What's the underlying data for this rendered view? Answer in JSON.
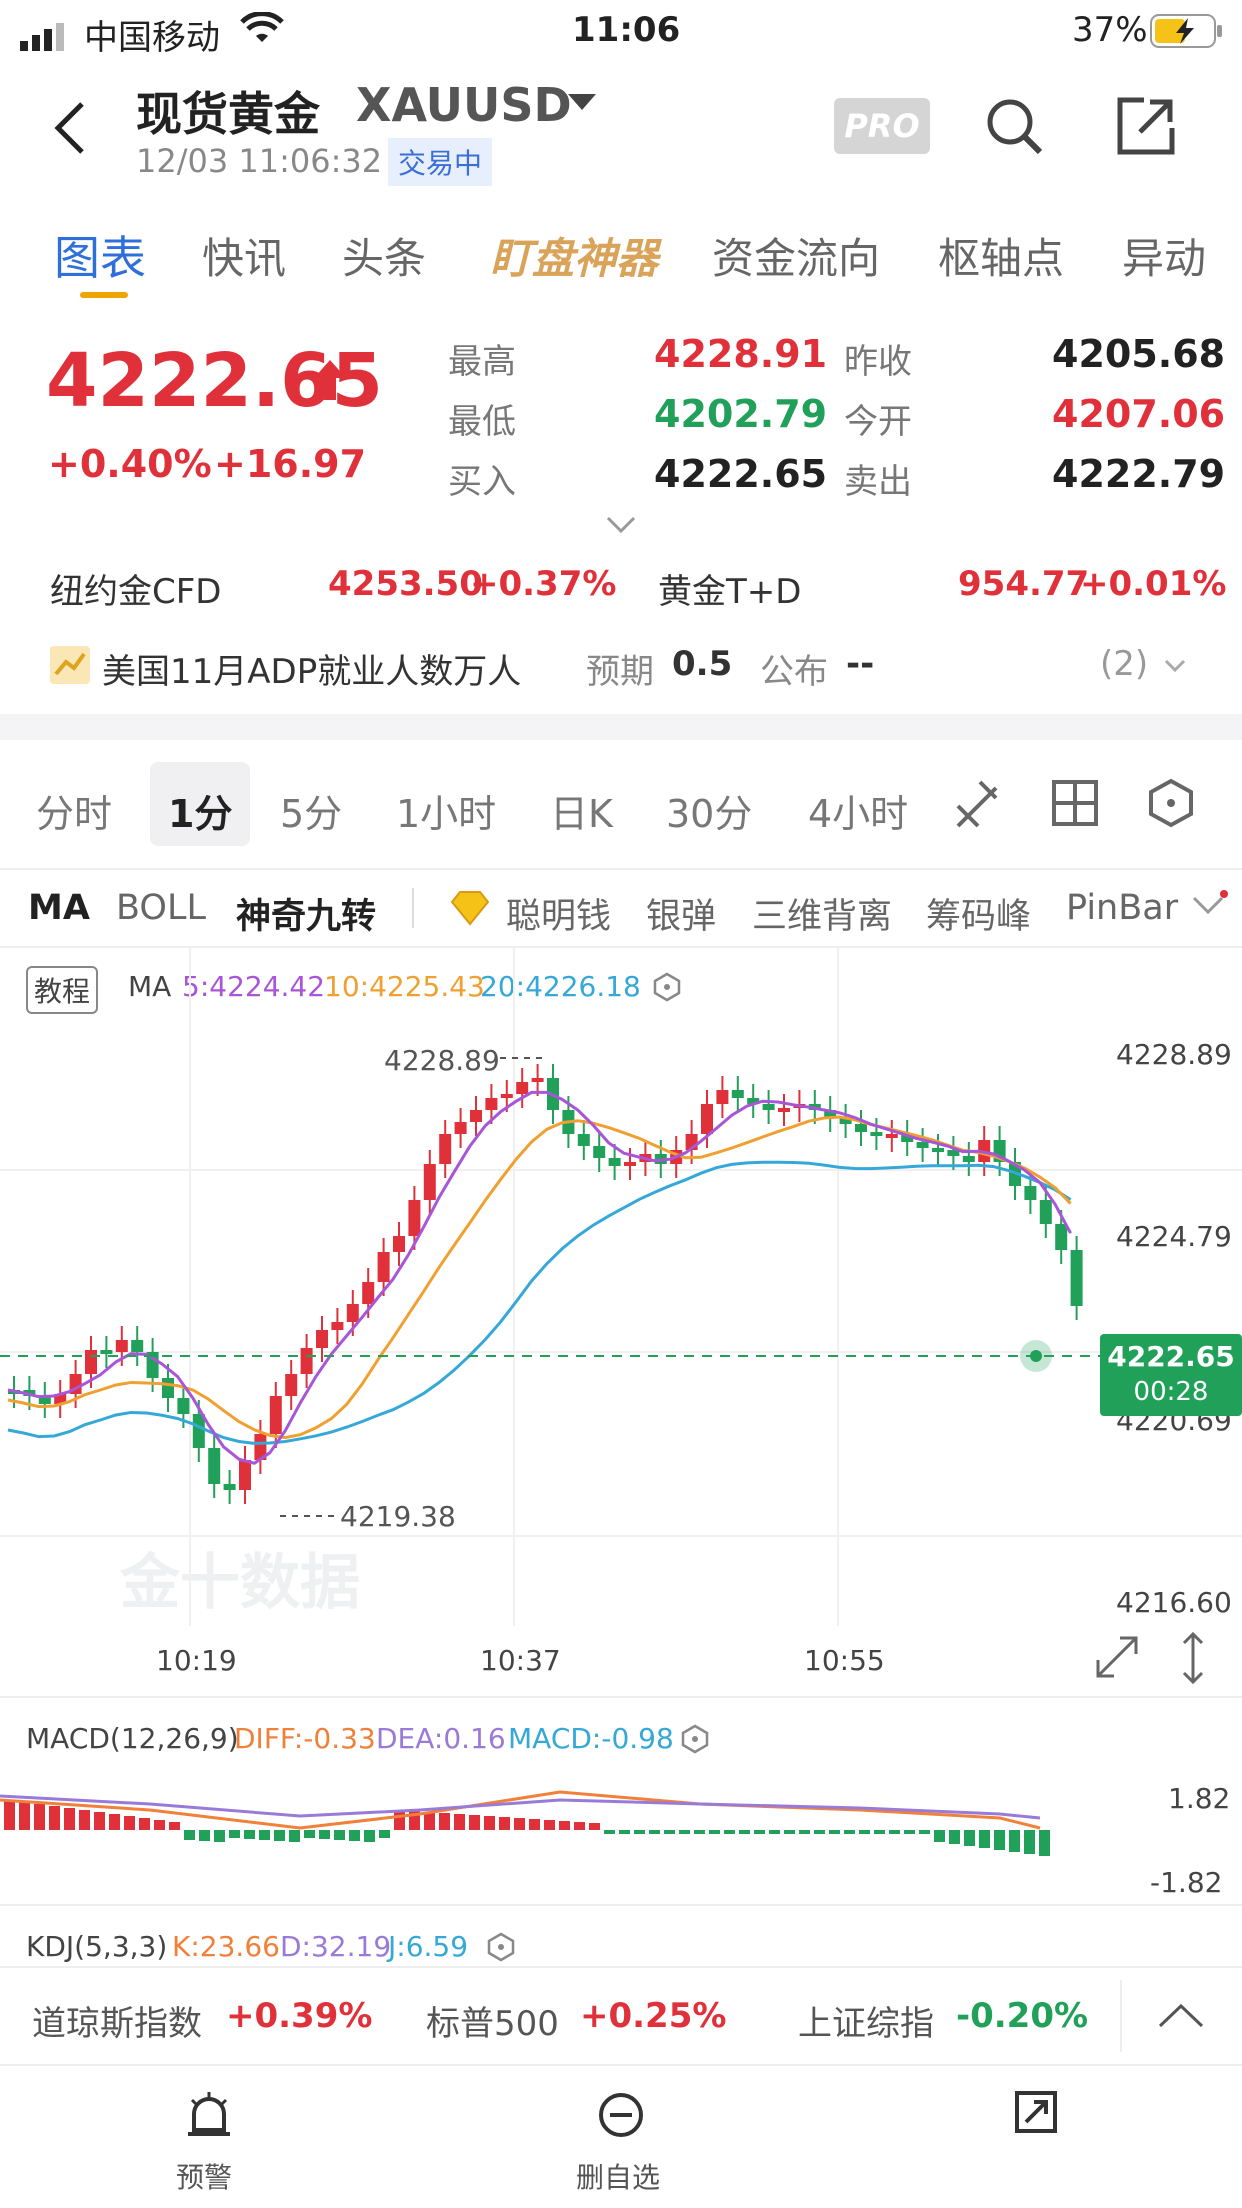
{
  "status_bar": {
    "carrier": "中国移动",
    "time": "11:06",
    "battery": "37%"
  },
  "header": {
    "title": "现货黄金",
    "symbol": "XAUUSD",
    "datetime": "12/03 11:06:32",
    "trade_status": "交易中",
    "pro_badge": "PRO"
  },
  "tabs": [
    "图表",
    "快讯",
    "头条",
    "盯盘神器",
    "资金流向",
    "枢轴点",
    "异动"
  ],
  "quote": {
    "price": "4222.65",
    "change_pct": "+0.40%",
    "change": "+16.97",
    "high_label": "最高",
    "high": "4228.91",
    "low_label": "最低",
    "low": "4202.79",
    "bid_label": "买入",
    "bid": "4222.65",
    "prev_close_label": "昨收",
    "prev_close": "4205.68",
    "open_label": "今开",
    "open": "4207.06",
    "ask_label": "卖出",
    "ask": "4222.79"
  },
  "related": [
    {
      "name": "纽约金CFD",
      "price": "4253.50",
      "pct": "+0.37%"
    },
    {
      "name": "黄金T+D",
      "price": "954.77",
      "pct": "+0.01%"
    }
  ],
  "event": {
    "title": "美国11月ADP就业人数万人",
    "expected_label": "预期",
    "expected": "0.5",
    "published_label": "公布",
    "published": "--",
    "count": "(2)"
  },
  "period_tabs": [
    "分时",
    "1分",
    "5分",
    "1小时",
    "日K",
    "30分",
    "4小时"
  ],
  "indicators": [
    "MA",
    "BOLL",
    "神奇九转",
    "聪明钱",
    "银弹",
    "三维背离",
    "筹码峰",
    "PinBar"
  ],
  "chart": {
    "tutorial": "教程",
    "ma_label": "MA",
    "ma5": "5:4224.42",
    "ma10": "10:4225.43",
    "ma20": "20:4226.18",
    "y_labels": [
      "4228.89",
      "4224.79",
      "4220.69",
      "4216.60"
    ],
    "x_labels": [
      "10:19",
      "10:37",
      "10:55"
    ],
    "high_mark": "4228.89",
    "low_mark": "4219.38",
    "current_price": "4222.65",
    "countdown": "00:28",
    "watermark": "金十数据",
    "colors": {
      "ma5": "#a855d8",
      "ma10": "#f0a030",
      "ma20": "#35a8d8",
      "up": "#e0313b",
      "down": "#21a05a"
    }
  },
  "macd": {
    "label": "MACD(12,26,9)",
    "diff": "DIFF:-0.33",
    "dea": "DEA:0.16",
    "macd": "MACD:-0.98",
    "y_top": "1.82",
    "y_bottom": "-1.82"
  },
  "kdj": {
    "label": "KDJ(5,3,3)",
    "k": "K:23.66",
    "d": "D:32.19",
    "j": "J:6.59"
  },
  "indices": [
    {
      "name": "道琼斯指数",
      "pct": "+0.39%"
    },
    {
      "name": "标普500",
      "pct": "+0.25%"
    },
    {
      "name": "上证综指",
      "pct": "-0.20%"
    }
  ],
  "bottom_nav": [
    "预警",
    "删自选"
  ]
}
